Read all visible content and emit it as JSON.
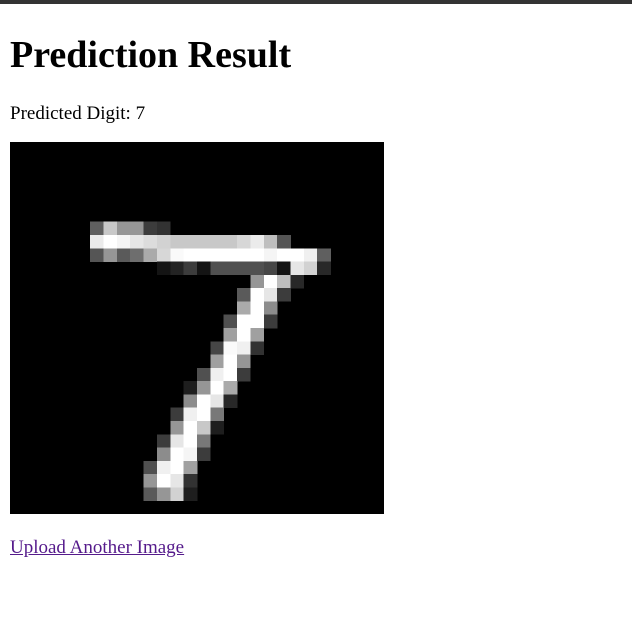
{
  "page": {
    "title": "Prediction Result",
    "prediction_label": "Predicted Digit:",
    "predicted_digit": "7",
    "link_label": "Upload Another Image",
    "link_color": "#551a8b"
  },
  "image": {
    "description_name": "handwritten-digit-image",
    "grid_size": 28
  }
}
